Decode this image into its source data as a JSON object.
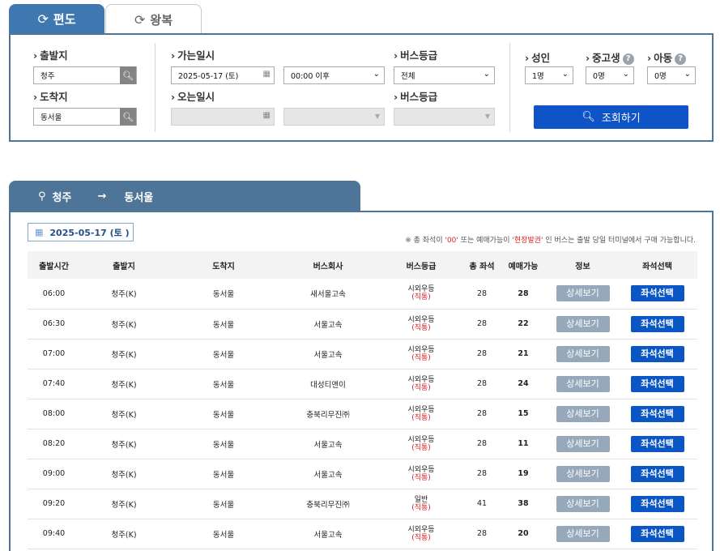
{
  "tabs": {
    "oneway": "편도",
    "roundtrip": "왕복"
  },
  "search": {
    "departure_label": "출발지",
    "departure_value": "청주",
    "arrival_label": "도착지",
    "arrival_value": "동서울",
    "go_date_label": "가는일시",
    "go_date_value": "2025-05-17 (토)",
    "go_time_value": "00:00 이후",
    "return_date_label": "오는일시",
    "bus_grade_label": "버스등급",
    "bus_grade_value": "전체",
    "bus_grade_label2": "버스등급",
    "adult_label": "성인",
    "adult_value": "1명",
    "student_label": "중고생",
    "student_value": "0명",
    "child_label": "아동",
    "child_value": "0명",
    "search_button": "조회하기"
  },
  "route": {
    "from": "청주",
    "to": "동서울",
    "date": "2025-05-17 (토 )"
  },
  "notice": {
    "prefix": "※ 총 좌석이 '",
    "zero": "00",
    "middle": "' 또는 예매가능이 '",
    "onsite": "현장발권",
    "suffix": "' 인 버스는 출발 당일 터미널에서 구매 가능합니다."
  },
  "columns": [
    "출발시간",
    "출발지",
    "도착지",
    "버스회사",
    "버스등급",
    "총 좌석",
    "예매가능",
    "정보",
    "좌석선택"
  ],
  "rows": [
    {
      "time": "06:00",
      "from": "청주(K)",
      "to": "동서울",
      "company": "새서울고속",
      "grade": "시외우등",
      "grade_sub": "(직통)",
      "total": "28",
      "avail": "28"
    },
    {
      "time": "06:30",
      "from": "청주(K)",
      "to": "동서울",
      "company": "서울고속",
      "grade": "시외우등",
      "grade_sub": "(직통)",
      "total": "28",
      "avail": "22"
    },
    {
      "time": "07:00",
      "from": "청주(K)",
      "to": "동서울",
      "company": "서울고속",
      "grade": "시외우등",
      "grade_sub": "(직통)",
      "total": "28",
      "avail": "21"
    },
    {
      "time": "07:40",
      "from": "청주(K)",
      "to": "동서울",
      "company": "대성티앤이",
      "grade": "시외우등",
      "grade_sub": "(직통)",
      "total": "28",
      "avail": "24"
    },
    {
      "time": "08:00",
      "from": "청주(K)",
      "to": "동서울",
      "company": "충북리무진㈜",
      "grade": "시외우등",
      "grade_sub": "(직통)",
      "total": "28",
      "avail": "15"
    },
    {
      "time": "08:20",
      "from": "청주(K)",
      "to": "동서울",
      "company": "서울고속",
      "grade": "시외우등",
      "grade_sub": "(직통)",
      "total": "28",
      "avail": "11"
    },
    {
      "time": "09:00",
      "from": "청주(K)",
      "to": "동서울",
      "company": "서울고속",
      "grade": "시외우등",
      "grade_sub": "(직통)",
      "total": "28",
      "avail": "19"
    },
    {
      "time": "09:20",
      "from": "청주(K)",
      "to": "동서울",
      "company": "충북리무진㈜",
      "grade": "일반",
      "grade_sub": "(직통)",
      "total": "41",
      "avail": "38"
    },
    {
      "time": "09:40",
      "from": "청주(K)",
      "to": "동서울",
      "company": "서울고속",
      "grade": "시외우등",
      "grade_sub": "(직통)",
      "total": "28",
      "avail": "20"
    }
  ],
  "row_buttons": {
    "detail": "상세보기",
    "seat": "좌석선택"
  }
}
